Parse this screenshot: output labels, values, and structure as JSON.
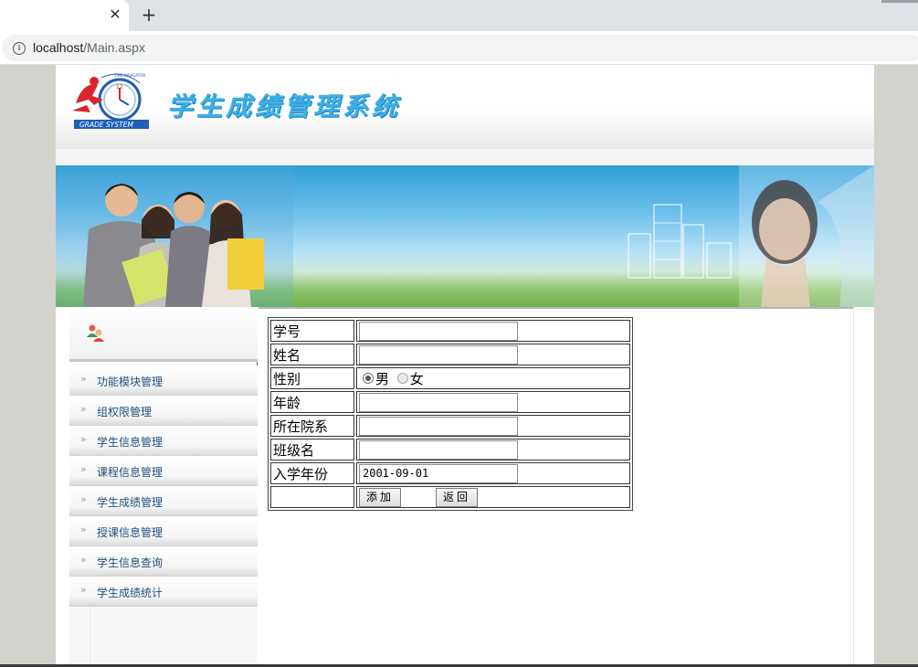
{
  "browser": {
    "close_glyph": "✕",
    "new_tab_glyph": "+",
    "info_glyph": "i",
    "url_host": "localhost",
    "url_path": "/Main.aspx"
  },
  "header": {
    "system_title": "学生成绩管理系统",
    "logo_text": "GRADE SYSTEM",
    "logo_arc_text": "TIME NAVIGATOR",
    "logo_clock_number": "12"
  },
  "sidebar": {
    "items": [
      {
        "label": "功能模块管理"
      },
      {
        "label": "组权限管理"
      },
      {
        "label": "学生信息管理"
      },
      {
        "label": "课程信息管理"
      },
      {
        "label": "学生成绩管理"
      },
      {
        "label": "授课信息管理"
      },
      {
        "label": "学生信息查询"
      },
      {
        "label": "学生成绩统计"
      }
    ],
    "arrow_glyph": "»"
  },
  "form": {
    "student_id_label": "学号",
    "student_id_value": "",
    "name_label": "姓名",
    "name_value": "",
    "gender_label": "性别",
    "gender_male": "男",
    "gender_female": "女",
    "gender_selected": "男",
    "age_label": "年龄",
    "age_value": "",
    "dept_label": "所在院系",
    "dept_value": "",
    "class_label": "班级名",
    "class_value": "",
    "enroll_label": "入学年份",
    "enroll_value": "2001-09-01",
    "add_button": "添加",
    "back_button": "返回"
  },
  "colors": {
    "title_blue": "#3fb0e6",
    "menu_text": "#1d4f7f",
    "page_background": "#d2d3cd"
  }
}
